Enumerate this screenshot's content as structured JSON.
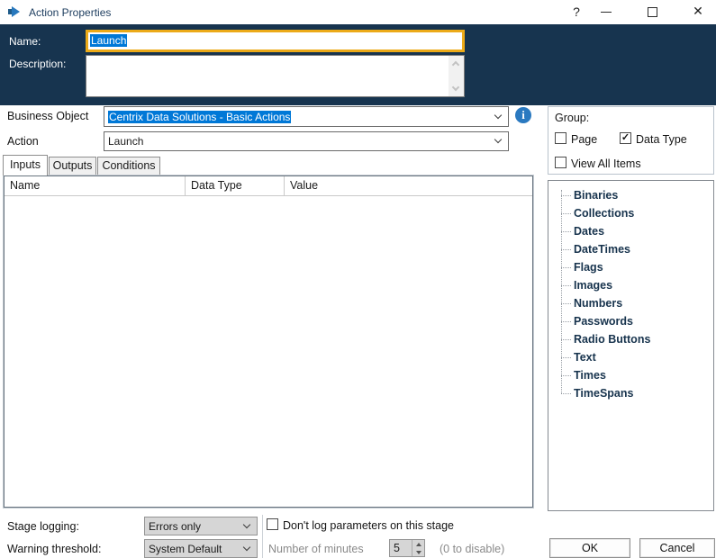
{
  "window": {
    "title": "Action Properties",
    "help_glyph": "?",
    "close_glyph": "✕"
  },
  "header": {
    "name_label": "Name:",
    "name_value": "Launch",
    "description_label": "Description:",
    "description_value": ""
  },
  "form": {
    "business_object_label": "Business Object",
    "business_object_value": "Centrix Data Solutions - Basic Actions",
    "action_label": "Action",
    "action_value": "Launch",
    "info_glyph": "i"
  },
  "tabs": [
    {
      "label": "Inputs",
      "active": true
    },
    {
      "label": "Outputs",
      "active": false
    },
    {
      "label": "Conditions",
      "active": false
    }
  ],
  "grid": {
    "columns": [
      "Name",
      "Data Type",
      "Value"
    ],
    "rows": []
  },
  "group_panel": {
    "title": "Group:",
    "page_label": "Page",
    "page_checked": false,
    "data_type_label": "Data Type",
    "data_type_checked": true,
    "view_all_label": "View All Items",
    "view_all_checked": false,
    "checkmark": "✓"
  },
  "tree": {
    "items": [
      "Binaries",
      "Collections",
      "Dates",
      "DateTimes",
      "Flags",
      "Images",
      "Numbers",
      "Passwords",
      "Radio Buttons",
      "Text",
      "Times",
      "TimeSpans"
    ]
  },
  "footer": {
    "stage_logging_label": "Stage logging:",
    "stage_logging_value": "Errors only",
    "dont_log_label": "Don't log parameters on this stage",
    "dont_log_checked": false,
    "warning_threshold_label": "Warning threshold:",
    "warning_threshold_value": "System Default",
    "minutes_label": "Number of minutes",
    "minutes_value": "5",
    "disable_hint": "(0 to disable)",
    "ok_label": "OK",
    "cancel_label": "Cancel"
  },
  "colors": {
    "header_navy": "#17344F",
    "name_border_gold": "#ECAA18",
    "selection_blue": "#0078D7",
    "info_icon_blue": "#2A79C0"
  }
}
